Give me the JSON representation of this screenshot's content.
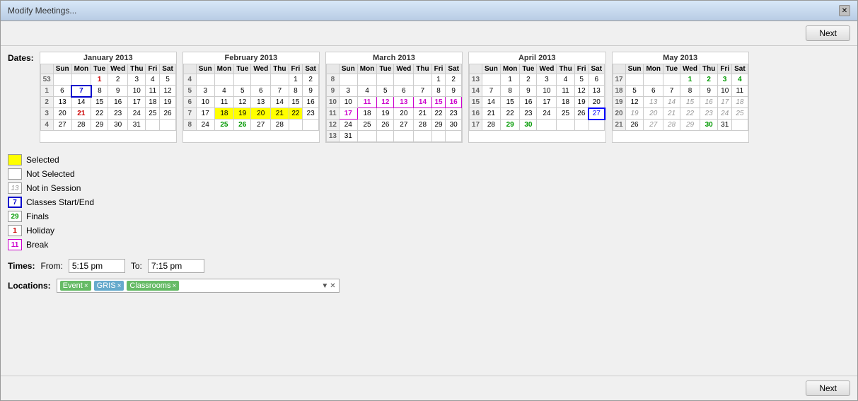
{
  "window": {
    "title": "Modify Meetings..."
  },
  "toolbar": {
    "next_label": "Next"
  },
  "footer": {
    "next_label": "Next"
  },
  "labels": {
    "dates": "Dates:",
    "times": "Times:",
    "from": "From:",
    "to": "To:",
    "locations": "Locations:"
  },
  "times": {
    "from": "5:15 pm",
    "to": "7:15 pm"
  },
  "locations": {
    "tags": [
      "Event ×",
      "GRIS ×",
      "Classrooms ×"
    ]
  },
  "legend": [
    {
      "label": "Selected",
      "bg": "#ffff00",
      "text": "",
      "border": "1px solid #999"
    },
    {
      "label": "Not Selected",
      "bg": "white",
      "text": "",
      "border": "1px solid #999"
    },
    {
      "label": "Not in Session",
      "bg": "white",
      "text": "13",
      "color": "#999",
      "italic": true,
      "border": "1px solid #999"
    },
    {
      "label": "Classes Start/End",
      "bg": "white",
      "text": "7",
      "color": "#0000cc",
      "bold": true,
      "border": "2px solid #0000cc"
    },
    {
      "label": "Finals",
      "bg": "white",
      "text": "29",
      "color": "#009900",
      "bold": true,
      "border": "1px solid #999"
    },
    {
      "label": "Holiday",
      "bg": "white",
      "text": "1",
      "color": "#cc0000",
      "bold": true,
      "border": "1px solid #999"
    },
    {
      "label": "Break",
      "bg": "white",
      "text": "11",
      "color": "#cc00cc",
      "bold": true,
      "border": "1px solid #cc00cc"
    }
  ],
  "calendars": [
    {
      "title": "January 2013",
      "days_header": [
        "",
        "Sun",
        "Mon",
        "Tue",
        "Wed",
        "Thu",
        "Fri",
        "Sat"
      ],
      "weeks": [
        {
          "week": "53",
          "days": [
            "",
            "",
            "",
            "1",
            "2",
            "3",
            "4",
            "5"
          ]
        },
        {
          "week": "1",
          "days": [
            "6",
            "7",
            "8",
            "9",
            "10",
            "11",
            "12"
          ]
        },
        {
          "week": "2",
          "days": [
            "13",
            "14",
            "15",
            "16",
            "17",
            "18",
            "19"
          ]
        },
        {
          "week": "3",
          "days": [
            "20",
            "21",
            "22",
            "23",
            "24",
            "25",
            "26"
          ]
        },
        {
          "week": "4",
          "days": [
            "27",
            "28",
            "29",
            "30",
            "31",
            "",
            ""
          ]
        }
      ]
    },
    {
      "title": "February 2013",
      "days_header": [
        "",
        "Sun",
        "Mon",
        "Tue",
        "Wed",
        "Thu",
        "Fri",
        "Sat"
      ],
      "weeks": [
        {
          "week": "4",
          "days": [
            "",
            "",
            "",
            "",
            "",
            "",
            "1",
            "2"
          ]
        },
        {
          "week": "5",
          "days": [
            "3",
            "4",
            "5",
            "6",
            "7",
            "8",
            "9"
          ]
        },
        {
          "week": "6",
          "days": [
            "10",
            "11",
            "12",
            "13",
            "14",
            "15",
            "16"
          ]
        },
        {
          "week": "7",
          "days": [
            "17",
            "18",
            "19",
            "20",
            "21",
            "22",
            "23"
          ]
        },
        {
          "week": "8",
          "days": [
            "24",
            "25",
            "26",
            "27",
            "28",
            "",
            ""
          ]
        }
      ]
    },
    {
      "title": "March 2013",
      "days_header": [
        "",
        "Sun",
        "Mon",
        "Tue",
        "Wed",
        "Thu",
        "Fri",
        "Sat"
      ],
      "weeks": [
        {
          "week": "8",
          "days": [
            "",
            "",
            "",
            "",
            "",
            "",
            "1",
            "2"
          ]
        },
        {
          "week": "9",
          "days": [
            "3",
            "4",
            "5",
            "6",
            "7",
            "8",
            "9"
          ]
        },
        {
          "week": "10",
          "days": [
            "10",
            "11",
            "12",
            "13",
            "14",
            "15",
            "16"
          ]
        },
        {
          "week": "11",
          "days": [
            "17",
            "18",
            "19",
            "20",
            "21",
            "22",
            "23"
          ]
        },
        {
          "week": "12",
          "days": [
            "24",
            "25",
            "26",
            "27",
            "28",
            "29",
            "30"
          ]
        },
        {
          "week": "13",
          "days": [
            "31",
            "",
            "",
            "",
            "",
            "",
            ""
          ]
        }
      ]
    },
    {
      "title": "April 2013",
      "days_header": [
        "",
        "Sun",
        "Mon",
        "Tue",
        "Wed",
        "Thu",
        "Fri",
        "Sat"
      ],
      "weeks": [
        {
          "week": "13",
          "days": [
            "",
            "1",
            "2",
            "3",
            "4",
            "5",
            "6"
          ]
        },
        {
          "week": "14",
          "days": [
            "7",
            "8",
            "9",
            "10",
            "11",
            "12",
            "13"
          ]
        },
        {
          "week": "15",
          "days": [
            "14",
            "15",
            "16",
            "17",
            "18",
            "19",
            "20"
          ]
        },
        {
          "week": "16",
          "days": [
            "21",
            "22",
            "23",
            "24",
            "25",
            "26",
            "27"
          ]
        },
        {
          "week": "17",
          "days": [
            "28",
            "29",
            "30",
            "",
            "",
            "",
            ""
          ]
        }
      ]
    },
    {
      "title": "May 2013",
      "days_header": [
        "",
        "Sun",
        "Mon",
        "Tue",
        "Wed",
        "Thu",
        "Fri",
        "Sat"
      ],
      "weeks": [
        {
          "week": "17",
          "days": [
            "",
            "",
            "",
            "1",
            "2",
            "3",
            "4"
          ]
        },
        {
          "week": "18",
          "days": [
            "5",
            "6",
            "7",
            "8",
            "9",
            "10",
            "11"
          ]
        },
        {
          "week": "19",
          "days": [
            "12",
            "13",
            "14",
            "15",
            "16",
            "17",
            "18"
          ]
        },
        {
          "week": "20",
          "days": [
            "19",
            "20",
            "21",
            "22",
            "23",
            "24",
            "25"
          ]
        },
        {
          "week": "21",
          "days": [
            "26",
            "27",
            "28",
            "29",
            "30",
            "31",
            ""
          ]
        }
      ]
    }
  ]
}
